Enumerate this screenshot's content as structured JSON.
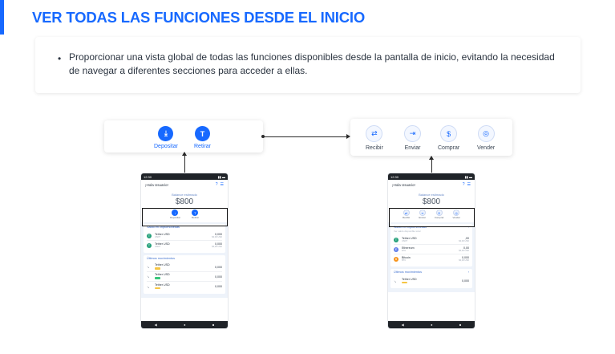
{
  "slide": {
    "title": "VER TODAS LAS FUNCIONES DESDE EL INICIO",
    "bullet_marker": "•",
    "description": "Proporcionar una vista global de todas las funciones disponibles desde la pantalla de inicio, evitando la necesidad de navegar a diferentes secciones para acceder a ellas."
  },
  "zoom_left": {
    "actions": [
      {
        "label": "Depositar",
        "icon": "download-icon",
        "glyph": "⤓"
      },
      {
        "label": "Retirar",
        "icon": "token-icon",
        "glyph": "T"
      }
    ]
  },
  "zoom_right": {
    "actions": [
      {
        "label": "Recibir",
        "icon": "receive-icon",
        "glyph": "⇄"
      },
      {
        "label": "Enviar",
        "icon": "send-icon",
        "glyph": "⇥"
      },
      {
        "label": "Comprar",
        "icon": "buy-icon",
        "glyph": "$"
      },
      {
        "label": "Vender",
        "icon": "sell-icon",
        "glyph": "◎"
      }
    ]
  },
  "phone_left": {
    "time": "12:30",
    "greeting": "¡Hola Usuario!",
    "balance_label": "Balance estimado",
    "balance_value": "$800",
    "mini_actions": [
      "Depositar",
      "Retirar"
    ],
    "saldos_title": "Saldo en criptomonedas",
    "saldos": [
      {
        "name": "Tether USD",
        "sub": "USDT",
        "value": "0,000",
        "sub_value": "$0,00 USD",
        "color": "#26a17b",
        "glyph": "T"
      },
      {
        "name": "Tether USD",
        "sub": "USDT",
        "value": "0,000",
        "sub_value": "$0,00 USD",
        "color": "#26a17b",
        "glyph": "T"
      }
    ],
    "movimientos_title": "Últimos movimientos",
    "movimientos": [
      {
        "name": "Tether USD",
        "value": "0,000",
        "pill": "#f5c542"
      },
      {
        "name": "Tether USD",
        "value": "0,000",
        "pill": "#37c77a"
      },
      {
        "name": "Tether USD",
        "value": "0,000",
        "pill": "#f5c542"
      }
    ]
  },
  "phone_right": {
    "time": "12:30",
    "greeting": "¡Hola Usuario!",
    "balance_label": "Balance estimado",
    "balance_value": "$800",
    "mini_actions": [
      "Recibir",
      "Enviar",
      "Comprar",
      "Vender"
    ],
    "saldos_title": "Saldo en criptomonedas",
    "saldos_sub": "Ver saldo disponible total",
    "saldos": [
      {
        "name": "Tether USD",
        "sub": "USDT",
        "value": ",00",
        "sub_value": "$0,00 USD",
        "color": "#26a17b",
        "glyph": "T"
      },
      {
        "name": "Ethereum",
        "sub": "ETH",
        "value": "0,00",
        "sub_value": "$0,00 USD",
        "color": "#627eea",
        "glyph": "E"
      },
      {
        "name": "Bitcoin",
        "sub": "BTC",
        "value": "0,000",
        "sub_value": "$0,00 USD",
        "color": "#f7931a",
        "glyph": "B"
      }
    ],
    "movimientos_title": "Últimos movimientos",
    "movimientos": [
      {
        "name": "Tether USD",
        "value": "0,000",
        "pill": "#f5c542"
      }
    ]
  },
  "nav": {
    "back": "◀",
    "home": "●",
    "recent": "■"
  }
}
